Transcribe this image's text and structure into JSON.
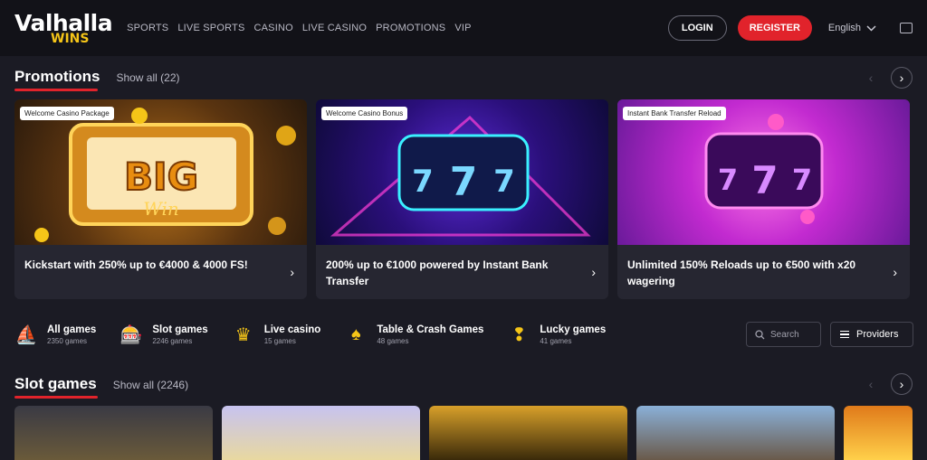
{
  "logo": {
    "main": "Valhalla",
    "sub": "WINS"
  },
  "nav": [
    "SPORTS",
    "LIVE SPORTS",
    "CASINO",
    "LIVE CASINO",
    "PROMOTIONS",
    "VIP"
  ],
  "header": {
    "login": "LOGIN",
    "register": "REGISTER",
    "language": "English"
  },
  "promotions": {
    "title": "Promotions",
    "show_all": "Show all (22)",
    "cards": [
      {
        "badge": "Welcome Casino Package",
        "text": "Kickstart with 250% up to €4000 & 4000 FS!"
      },
      {
        "badge": "Welcome Casino Bonus",
        "text": "200% up to €1000 powered by Instant Bank Transfer"
      },
      {
        "badge": "Instant Bank Transfer Reload",
        "text": "Unlimited 150% Reloads up to €500 with x20 wagering"
      }
    ]
  },
  "categories": [
    {
      "name": "All games",
      "count": "2350 games",
      "icon": "ship-icon"
    },
    {
      "name": "Slot games",
      "count": "2246 games",
      "icon": "slot-machine-icon"
    },
    {
      "name": "Live casino",
      "count": "15 games",
      "icon": "table-icon"
    },
    {
      "name": "Table & Crash Games",
      "count": "48 games",
      "icon": "card-icon"
    },
    {
      "name": "Lucky games",
      "count": "41 games",
      "icon": "lucky-icon"
    }
  ],
  "tools": {
    "search": "Search",
    "providers": "Providers"
  },
  "slot_games": {
    "title": "Slot games",
    "show_all": "Show all (2246)"
  },
  "colors": {
    "accent": "#e1232b",
    "gold": "#f5c518",
    "bg": "#1b1b24"
  }
}
